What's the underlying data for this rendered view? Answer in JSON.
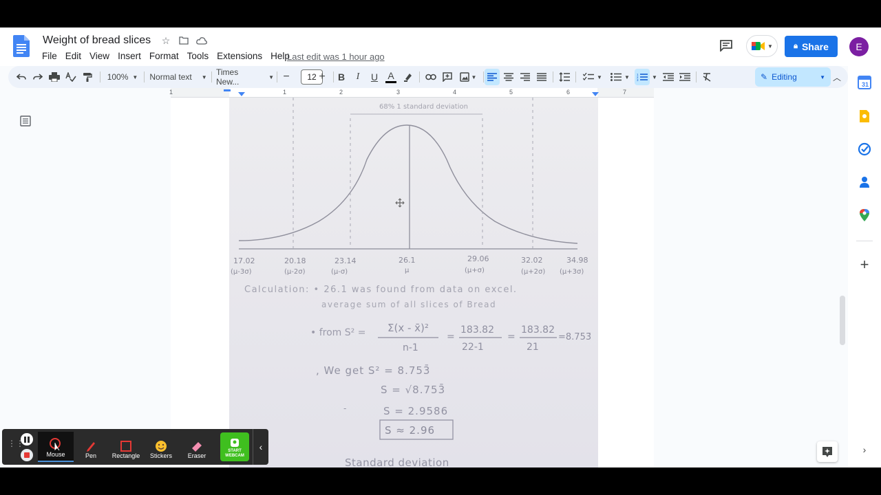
{
  "app": {
    "title": "Weight of bread slices",
    "last_edit": "Last edit was 1 hour ago",
    "share_label": "Share",
    "avatar_letter": "E",
    "brand_color": "#1a73e8"
  },
  "menu": [
    "File",
    "Edit",
    "View",
    "Insert",
    "Format",
    "Tools",
    "Extensions",
    "Help"
  ],
  "toolbar": {
    "zoom": "100%",
    "style": "Normal text",
    "font": "Times New...",
    "font_size": "12",
    "mode": "Editing"
  },
  "ruler": {
    "numbers": [
      "1",
      "1",
      "2",
      "3",
      "4",
      "5",
      "6",
      "7"
    ]
  },
  "document": {
    "figure_title": "68% 1 standard deviation",
    "tick_values": [
      "17.02",
      "20.18",
      "23.14",
      "26.1",
      "29.06",
      "32.02",
      "34.98"
    ],
    "tick_sub": [
      "(μ-3σ)",
      "(μ-2σ)",
      "(μ-σ)",
      "μ",
      "(μ+σ)",
      "(μ+2σ)",
      "(μ+3σ)"
    ],
    "calc_line1": "Calculation: • 26.1 was found from data on excel.",
    "calc_line2": "average sum of all slices of Bread",
    "formula_prefix": "• from  S² =",
    "formula_num": "Σ(x - x̄)²",
    "formula_den": "n-1",
    "frac2_num": "183.82",
    "frac2_den": "22-1",
    "frac3_num": "183.82",
    "frac3_den": "21",
    "formula_result": "=8.753̄",
    "we_get": ", We  get  S² = 8.753̄",
    "sqrt_line": "S = √8.753̄",
    "s_line": "S = 2.9586",
    "s_approx": "S ≈ 2.96",
    "footer_text": "Standard deviation"
  },
  "recorder": {
    "tools": [
      "Mouse",
      "Pen",
      "Rectangle",
      "Stickers",
      "Eraser"
    ],
    "webcam_label": "START WEBCAM"
  }
}
